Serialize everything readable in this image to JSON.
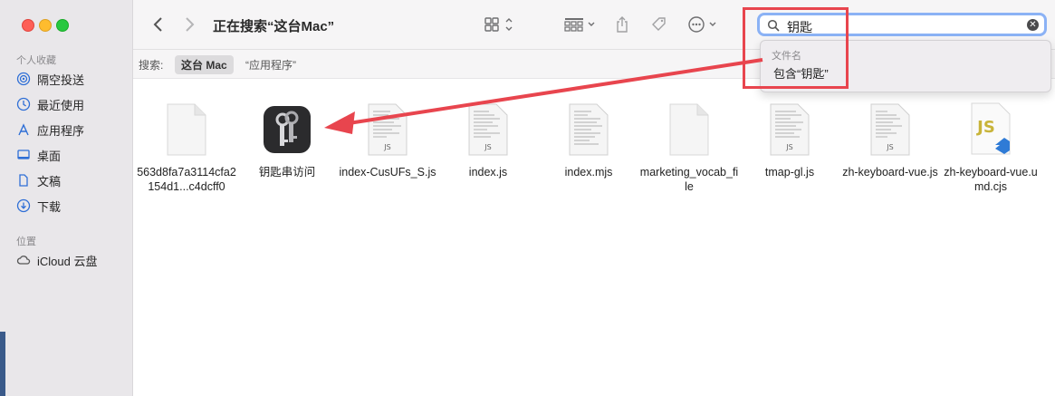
{
  "window": {
    "title": "正在搜索“这台Mac”"
  },
  "sidebar": {
    "favorites_header": "个人收藏",
    "items": [
      {
        "label": "隔空投送",
        "icon": "airdrop-icon"
      },
      {
        "label": "最近使用",
        "icon": "clock-icon"
      },
      {
        "label": "应用程序",
        "icon": "applications-icon"
      },
      {
        "label": "桌面",
        "icon": "desktop-icon"
      },
      {
        "label": "文稿",
        "icon": "document-icon"
      },
      {
        "label": "下载",
        "icon": "download-icon"
      }
    ],
    "locations_header": "位置",
    "locations": [
      {
        "label": "iCloud 云盘",
        "icon": "icloud-icon"
      }
    ]
  },
  "search": {
    "query": "钥匙"
  },
  "scope": {
    "label": "搜索:",
    "selected": "这台 Mac",
    "other": "“应用程序”"
  },
  "dropdown": {
    "header": "文件名",
    "item": "包含“钥匙”"
  },
  "files": [
    {
      "name": "563d8fa7a3114cfa2154d1...c4dcff0",
      "icon": "blank-document-icon"
    },
    {
      "name": "钥匙串访问",
      "icon": "keychain-app-icon"
    },
    {
      "name": "index-CusUFs_S.js",
      "icon": "js-document-icon"
    },
    {
      "name": "index.js",
      "icon": "js-document-icon"
    },
    {
      "name": "index.mjs",
      "icon": "text-document-icon"
    },
    {
      "name": "marketing_vocab_file",
      "icon": "blank-document-icon"
    },
    {
      "name": "tmap-gl.js",
      "icon": "js-document-icon"
    },
    {
      "name": "zh-keyboard-vue.js",
      "icon": "js-document-icon"
    },
    {
      "name": "zh-keyboard-vue.umd.cjs",
      "icon": "vscode-js-icon"
    }
  ],
  "colors": {
    "annotation": "#e8454e",
    "search_focus": "#8bb2f5",
    "js_badge": "#c8b43a"
  }
}
